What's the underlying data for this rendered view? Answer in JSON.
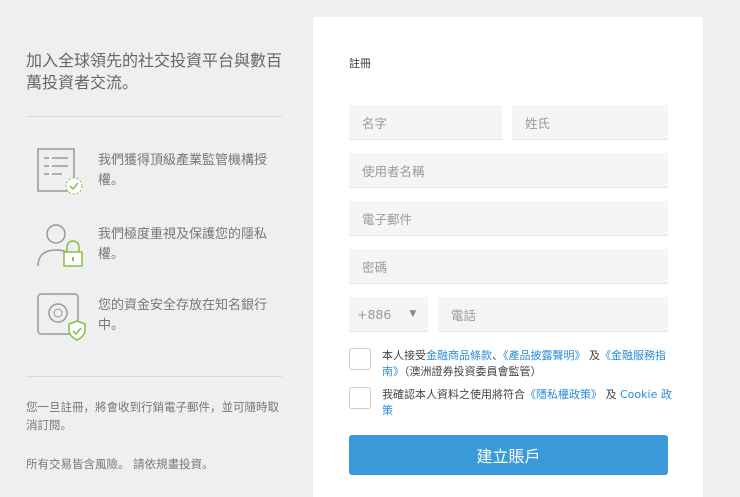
{
  "left": {
    "headline": "加入全球領先的社交投資平台與數百萬投資者交流。",
    "features": [
      {
        "icon": "checklist-icon",
        "text": "我們獲得頂級產業監管機構授權。"
      },
      {
        "icon": "user-lock-icon",
        "text": "我們極度重視及保護您的隱私權。"
      },
      {
        "icon": "safe-icon",
        "text": "您的資金安全存放在知名銀行中。"
      }
    ],
    "note1": "您一旦註冊，將會收到行銷電子郵件，並可隨時取消訂閱。",
    "note2": "所有交易皆含風險。 請依規畫投資。"
  },
  "form": {
    "title": "註冊",
    "first_name": "名字",
    "last_name": "姓氏",
    "username": "使用者名稱",
    "email": "電子郵件",
    "password": "密碼",
    "country_code": "+886",
    "phone": "電話",
    "terms": {
      "prefix": "本人接受",
      "link1": "金融商品條款",
      "sep": "、",
      "link2": "《產品披露聲明》",
      "and": "及",
      "link3": "《金融服務指南》",
      "suffix": "（澳洲證券投資委員會監管）"
    },
    "privacy": {
      "prefix": "我確認本人資料之使用將符合",
      "link1": "《隱私權政策》",
      "and": "及",
      "link2": "Cookie 政策"
    },
    "submit": "建立賬戶"
  },
  "colors": {
    "accent": "#3a9ad9",
    "link": "#2a8bd6",
    "icon_green": "#7dc242"
  }
}
